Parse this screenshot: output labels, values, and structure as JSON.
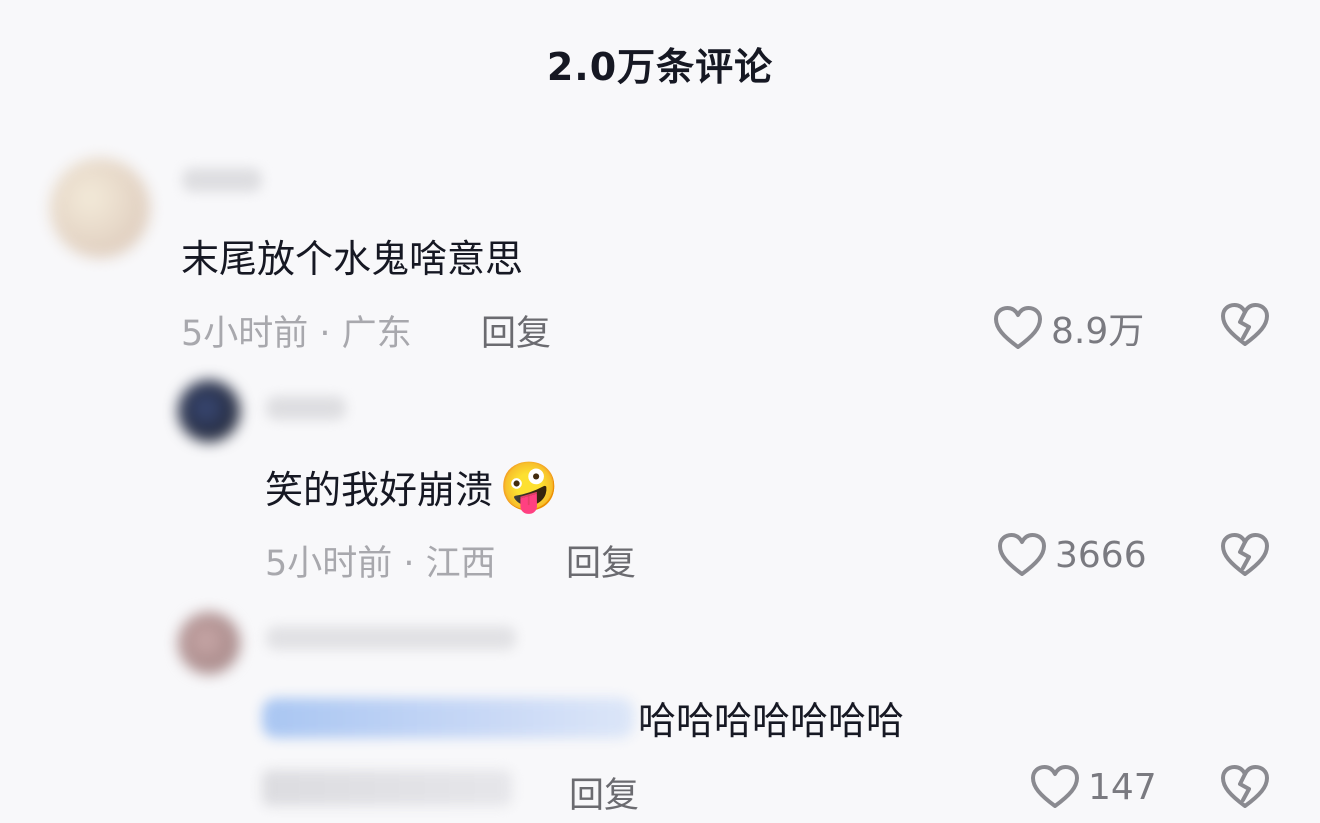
{
  "header": {
    "title": "2.0万条评论"
  },
  "comments": [
    {
      "text": "末尾放个水鬼啥意思",
      "time_location": "5小时前 · 广东",
      "reply_label": "回复",
      "likes": "8.9万",
      "avatar_color": "#e8ddd2"
    },
    {
      "text": "笑的我好崩溃",
      "emoji": "🤪",
      "time_location": "5小时前 · 江西",
      "reply_label": "回复",
      "likes": "3666",
      "avatar_color": "#2b3142"
    },
    {
      "text": "哈哈哈哈哈哈哈",
      "reply_label": "回复",
      "likes": "147",
      "avatar_color": "#b99a9a"
    }
  ],
  "icons": {
    "like": "heart-outline-icon",
    "dislike": "broken-heart-icon"
  },
  "colors": {
    "background": "#f8f8fa",
    "text_primary": "#161823",
    "text_secondary": "#a8a8ad",
    "mention_blue": "#a9c6f2"
  }
}
